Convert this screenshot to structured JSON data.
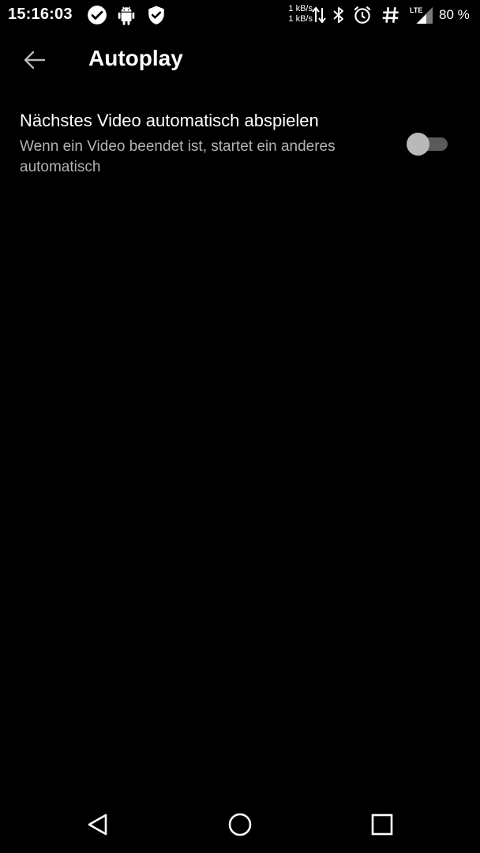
{
  "status_bar": {
    "time": "15:16:03",
    "net_speed_up": "1 kB/s",
    "net_speed_down": "1 kB/s",
    "network_type": "LTE",
    "battery": "80 %",
    "icons": [
      "check-circle-icon",
      "android-icon",
      "shield-check-icon",
      "data-arrows-icon",
      "bluetooth-icon",
      "alarm-icon",
      "hashtag-icon",
      "signal-icon"
    ]
  },
  "app_bar": {
    "back_icon": "arrow-back-icon",
    "title": "Autoplay"
  },
  "setting": {
    "title": "Nächstes Video automatisch abspielen",
    "summary": "Wenn ein Video beendet ist, startet ein anderes automatisch",
    "toggle_state": "off"
  },
  "nav_bar": {
    "icons": [
      "nav-back-icon",
      "nav-home-icon",
      "nav-recents-icon"
    ]
  },
  "colors": {
    "background": "#000000",
    "text_primary": "#ffffff",
    "text_secondary": "#b3b3b3",
    "toggle_track_off": "#5a5a5a",
    "toggle_thumb_off": "#b9b9b9"
  }
}
